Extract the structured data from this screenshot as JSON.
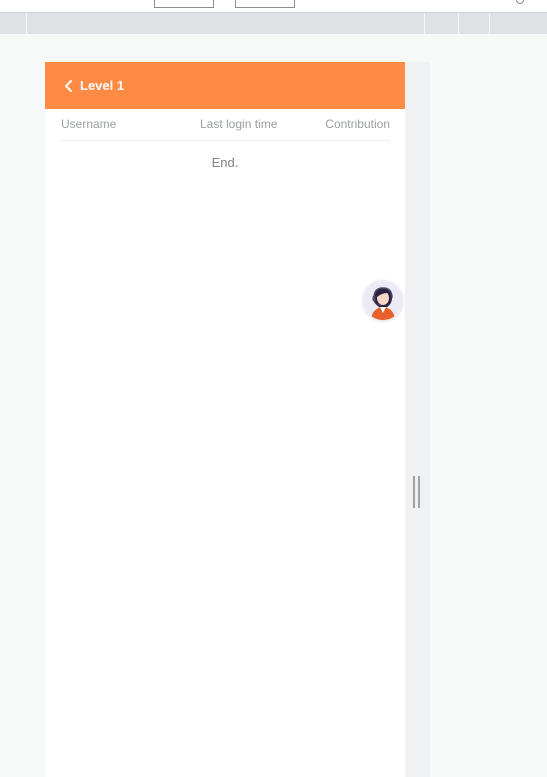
{
  "header": {
    "title": "Level 1"
  },
  "table": {
    "columns": [
      "Username",
      "Last login time",
      "Contribution"
    ],
    "end_text": "End."
  },
  "icons": {
    "back": "chevron-left-icon",
    "support": "customer-service-avatar-icon"
  },
  "colors": {
    "header_bg": "#ff8a44",
    "header_text": "#ffffff",
    "column_text": "#9a9da2",
    "end_text": "#7f8389"
  }
}
